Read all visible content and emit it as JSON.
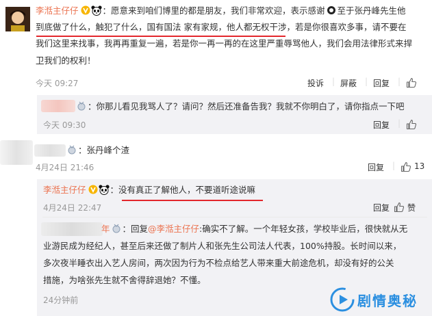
{
  "comment1": {
    "author": "李湉主仔仔",
    "line1": "：愿意来到咱们博里的都是朋友，我们非常欢迎，表示感谢",
    "line1b": "至于张丹峰先生他",
    "line2": "到底做了什么，触犯了什么，国有国法 家有家规，他人都无权干涉，若是你很喜欢多事，请不要在",
    "line3": "我们这里来找事，我再再重复一遍，若是你一再一再的在这里严重辱骂他人，我们会用法律形式来捍",
    "line4": "卫我们的权利！",
    "time": "今天 09:27",
    "actions": {
      "report": "投诉",
      "block": "屏蔽",
      "reply": "回复"
    }
  },
  "reply1": {
    "text": "：你那儿看见我骂人了？请问？然后还准备告我？我就不你明白了，请你指点一下吧",
    "time": "今天 09:30",
    "actions": {
      "reply": "回复"
    }
  },
  "comment2": {
    "text": "：张丹峰个渣",
    "time": "4月24日 21:46",
    "actions": {
      "reply": "回复"
    },
    "likes": "13"
  },
  "reply2": {
    "author": "李湉主仔仔",
    "text": "：没有真正了解他人，不要道听途说嘛",
    "time": "4月24日 22:47",
    "actions": {
      "reply": "回复",
      "like": "赞"
    }
  },
  "reply3": {
    "name_tail": "年",
    "prefix": "：回复",
    "mention": "@李湉主仔仔",
    "line1_rest": ":确实不了解。一个年轻女孩，学校毕业后，很快就从无",
    "line2": "业游民成为经纪人，甚至后来还做了制片人和张先生公司法人代表，100%持股。长时间以来，",
    "line3": "多次夜半睡衣出入艺人房间，两次因为行为不检点给艺人带来重大前途危机，却没有好的公关",
    "line4": "措施，为啥张先生就不舍得辞退她？不懂。",
    "time": "24分钟前"
  },
  "watermark": "剧情奥秘",
  "colors": {
    "accent": "#eb7350",
    "underline": "#e3262b",
    "reply_bg": "#f2f2f5",
    "brand_blue": "#2b8fe0"
  }
}
